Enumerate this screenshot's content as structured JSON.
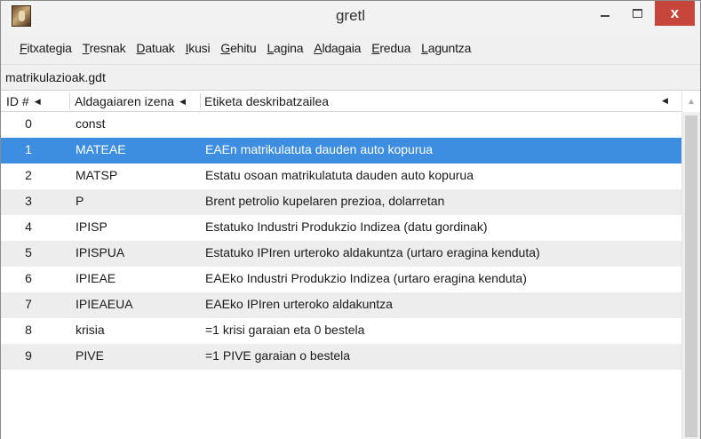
{
  "window": {
    "title": "gretl",
    "close_glyph": "x",
    "icon": "gretl-app-icon"
  },
  "menu": [
    {
      "accel": "F",
      "rest": "itxategia"
    },
    {
      "accel": "T",
      "rest": "resnak"
    },
    {
      "accel": "D",
      "rest": "atuak"
    },
    {
      "accel": "I",
      "rest": "kusi"
    },
    {
      "accel": "G",
      "rest": "ehitu"
    },
    {
      "accel": "L",
      "rest": "agina"
    },
    {
      "accel": "A",
      "rest": "ldagaia"
    },
    {
      "accel": "E",
      "rest": "redua"
    },
    {
      "accel": "L",
      "rest": "aguntza"
    }
  ],
  "file": {
    "name": "matrikulazioak.gdt"
  },
  "table": {
    "headers": {
      "id": "ID #",
      "name": "Aldagaiaren izena",
      "label": "Etiketa deskribatzailea"
    },
    "selected_index": 1,
    "rows": [
      {
        "id": "0",
        "name": "const",
        "label": ""
      },
      {
        "id": "1",
        "name": "MATEAE",
        "label": "EAEn matrikulatuta dauden auto kopurua"
      },
      {
        "id": "2",
        "name": "MATSP",
        "label": "Estatu osoan matrikulatuta dauden auto kopurua"
      },
      {
        "id": "3",
        "name": "P",
        "label": "Brent petrolio kupelaren prezioa, dolarretan"
      },
      {
        "id": "4",
        "name": "IPISP",
        "label": "Estatuko Industri Produkzio Indizea (datu gordinak)"
      },
      {
        "id": "5",
        "name": "IPISPUA",
        "label": "Estatuko IPIren urteroko aldakuntza (urtaro eragina kenduta)"
      },
      {
        "id": "6",
        "name": "IPIEAE",
        "label": "EAEko Industri Produkzio Indizea (urtaro eragina kenduta)"
      },
      {
        "id": "7",
        "name": "IPIEAEUA",
        "label": "EAEko IPIren urteroko aldakuntza"
      },
      {
        "id": "8",
        "name": "krisia",
        "label": "=1 krisi garaian eta 0 bestela"
      },
      {
        "id": "9",
        "name": "PIVE",
        "label": "=1 PIVE garaian o bestela"
      }
    ]
  },
  "colors": {
    "selection": "#3d8ee0",
    "close_button": "#c7463c",
    "alt_row": "#ededed"
  }
}
